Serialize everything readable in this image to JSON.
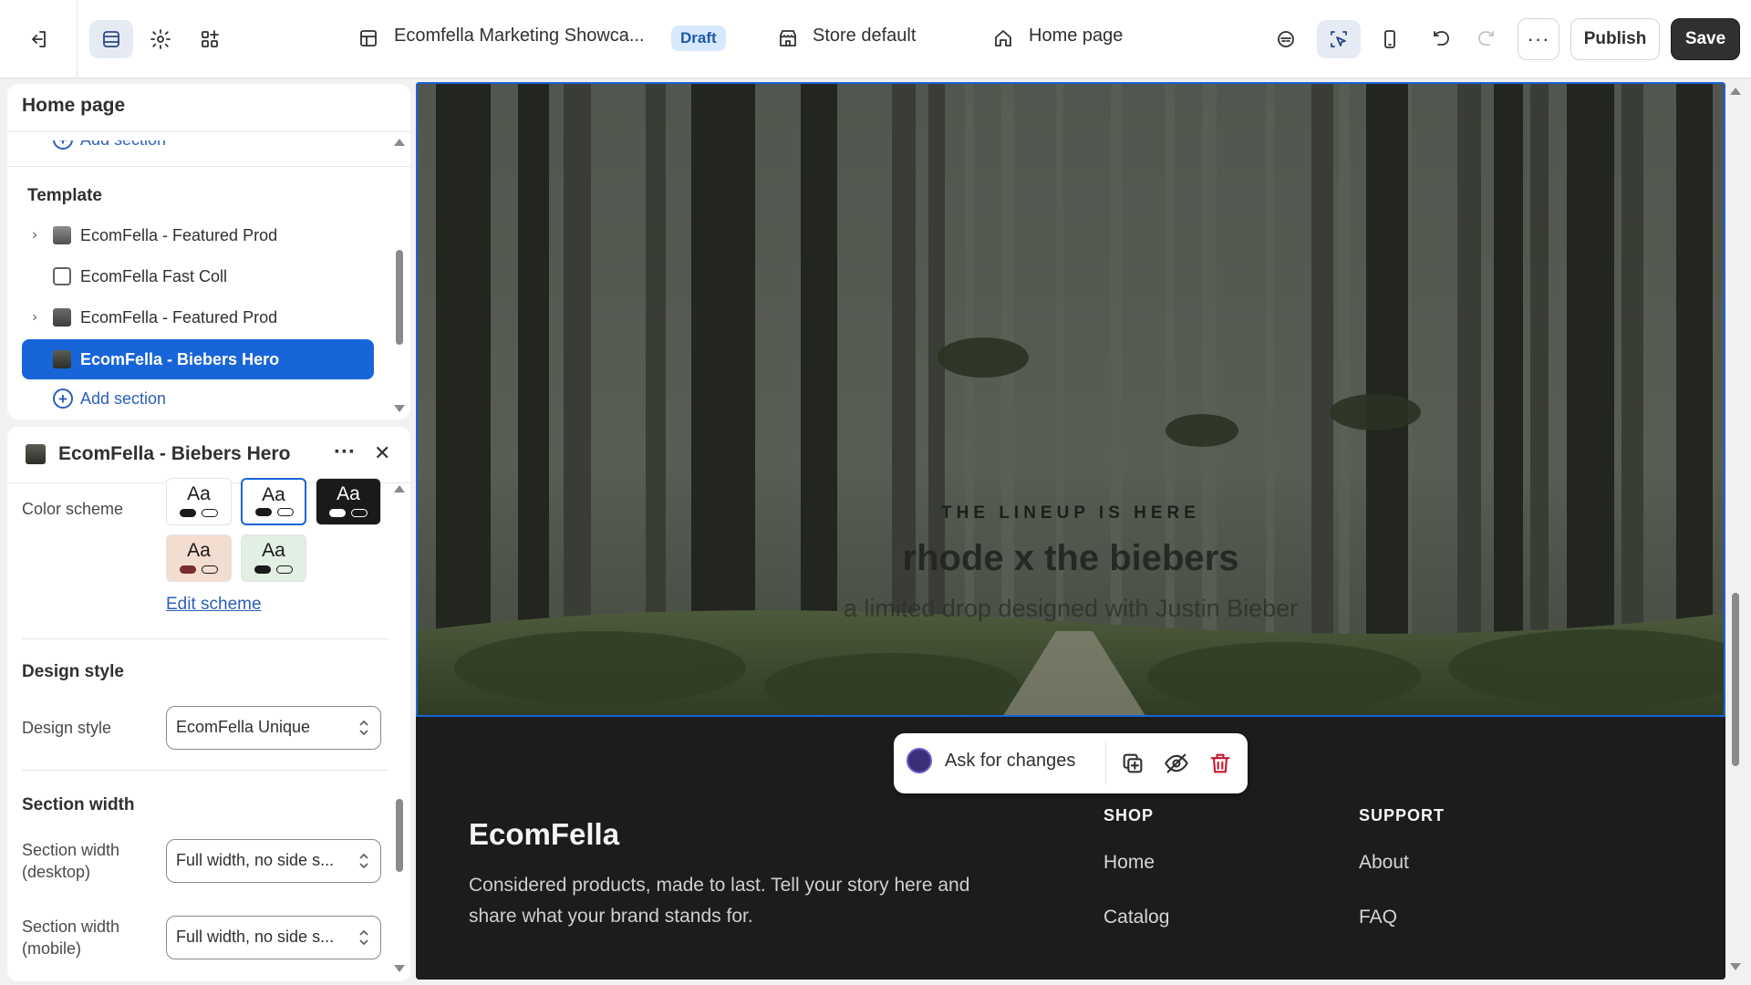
{
  "topbar": {
    "store_name": "Ecomfella Marketing Showca...",
    "status_badge": "Draft",
    "theme_setting": "Store default",
    "page_selector": "Home page",
    "publish_label": "Publish",
    "save_label": "Save",
    "more_label": "···",
    "icons": [
      "exit-icon",
      "sections-icon",
      "settings-icon",
      "apps-icon",
      "layout-icon",
      "store-icon",
      "home-icon",
      "ai-assistant-icon",
      "inspector-icon",
      "mobile-view-icon",
      "undo-icon",
      "redo-icon",
      "more-icon"
    ]
  },
  "sections_panel": {
    "title": "Home page",
    "add_section_top": "Add section",
    "template_heading": "Template",
    "items": [
      {
        "label": "EcomFella - Featured Prod",
        "has_chevron": true
      },
      {
        "label": "EcomFella Fast Coll",
        "has_chevron": false
      },
      {
        "label": "EcomFella - Featured Prod",
        "has_chevron": true
      },
      {
        "label": "EcomFella - Biebers Hero",
        "has_chevron": false,
        "selected": true
      }
    ],
    "add_section_bottom": "Add section"
  },
  "settings_panel": {
    "title": "EcomFella - Biebers Hero",
    "more_label": "···",
    "close_label": "✕",
    "color_scheme_label": "Color scheme",
    "swatch_text": "Aa",
    "swatches": [
      {
        "bg": "#ffffff",
        "fg": "#1a1a1a",
        "selected": false
      },
      {
        "bg": "#ffffff",
        "fg": "#1a1a1a",
        "selected": true
      },
      {
        "bg": "#1a1a1a",
        "fg": "#ffffff",
        "selected": false
      },
      {
        "bg": "#f3dcd0",
        "fg": "#1a1a1a",
        "selected": false
      },
      {
        "bg": "#e2efe3",
        "fg": "#1a1a1a",
        "selected": false
      }
    ],
    "edit_scheme": "Edit scheme",
    "design_style_heading": "Design style",
    "design_style_label": "Design style",
    "design_style_value": "EcomFella Unique",
    "section_width_heading": "Section width",
    "section_width_desktop_label_1": "Section width",
    "section_width_desktop_label_2": "(desktop)",
    "section_width_desktop_value": "Full width, no side s...",
    "section_width_mobile_label_1": "Section width",
    "section_width_mobile_label_2": "(mobile)",
    "section_width_mobile_value": "Full width, no side s..."
  },
  "preview": {
    "hero_tagline": "THE LINEUP IS HERE",
    "hero_title": "rhode x the biebers",
    "hero_subtitle": "a limited drop designed with Justin Bieber",
    "footer": {
      "brand": "EcomFella",
      "description": "Considered products, made to last. Tell your story here and share what your brand stands for.",
      "shop_heading": "SHOP",
      "shop_links": [
        "Home",
        "Catalog"
      ],
      "support_heading": "SUPPORT",
      "support_links": [
        "About",
        "FAQ"
      ]
    },
    "floating_toolbar": {
      "ask_label": "Ask for changes"
    }
  },
  "colors": {
    "accent": "#1765d8",
    "link": "#2c5fb9",
    "save_bg": "#303030",
    "draft_bg": "#d6e9ff",
    "delete": "#c4182f"
  }
}
